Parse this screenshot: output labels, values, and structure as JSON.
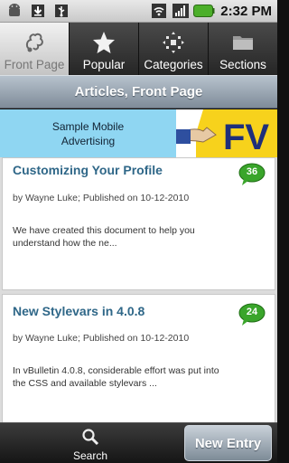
{
  "status_bar": {
    "time": "2:32 PM",
    "icons": [
      "android-icon",
      "download-icon",
      "usb-icon",
      "wifi-icon",
      "signal-icon",
      "battery-icon"
    ]
  },
  "tabs": [
    {
      "label": "Front Page",
      "icon": "front-page-icon",
      "active": true
    },
    {
      "label": "Popular",
      "icon": "star-icon",
      "active": false
    },
    {
      "label": "Categories",
      "icon": "categories-icon",
      "active": false
    },
    {
      "label": "Sections",
      "icon": "folder-icon",
      "active": false
    }
  ],
  "page_header": {
    "title": "Articles, Front Page"
  },
  "ad": {
    "line1": "Sample Mobile",
    "line2": "Advertising",
    "brand_fragment": "FV"
  },
  "articles": [
    {
      "title": "Customizing Your Profile",
      "meta": "by Wayne Luke; Published on 10-12-2010",
      "snippet": "We have created this document to help you understand how the ne...",
      "comments": "36"
    },
    {
      "title": "New Stylevars in 4.0.8",
      "meta": "by Wayne Luke; Published on 10-12-2010",
      "snippet": "In vBulletin 4.0.8, considerable effort was put into the CSS and available stylevars ...",
      "comments": "24"
    }
  ],
  "bottom_bar": {
    "search_label": "Search",
    "new_entry_label": "New Entry"
  },
  "colors": {
    "accent_green": "#3aa52b",
    "title_blue": "#2f6788",
    "ad_blue": "#8fd6f2"
  }
}
